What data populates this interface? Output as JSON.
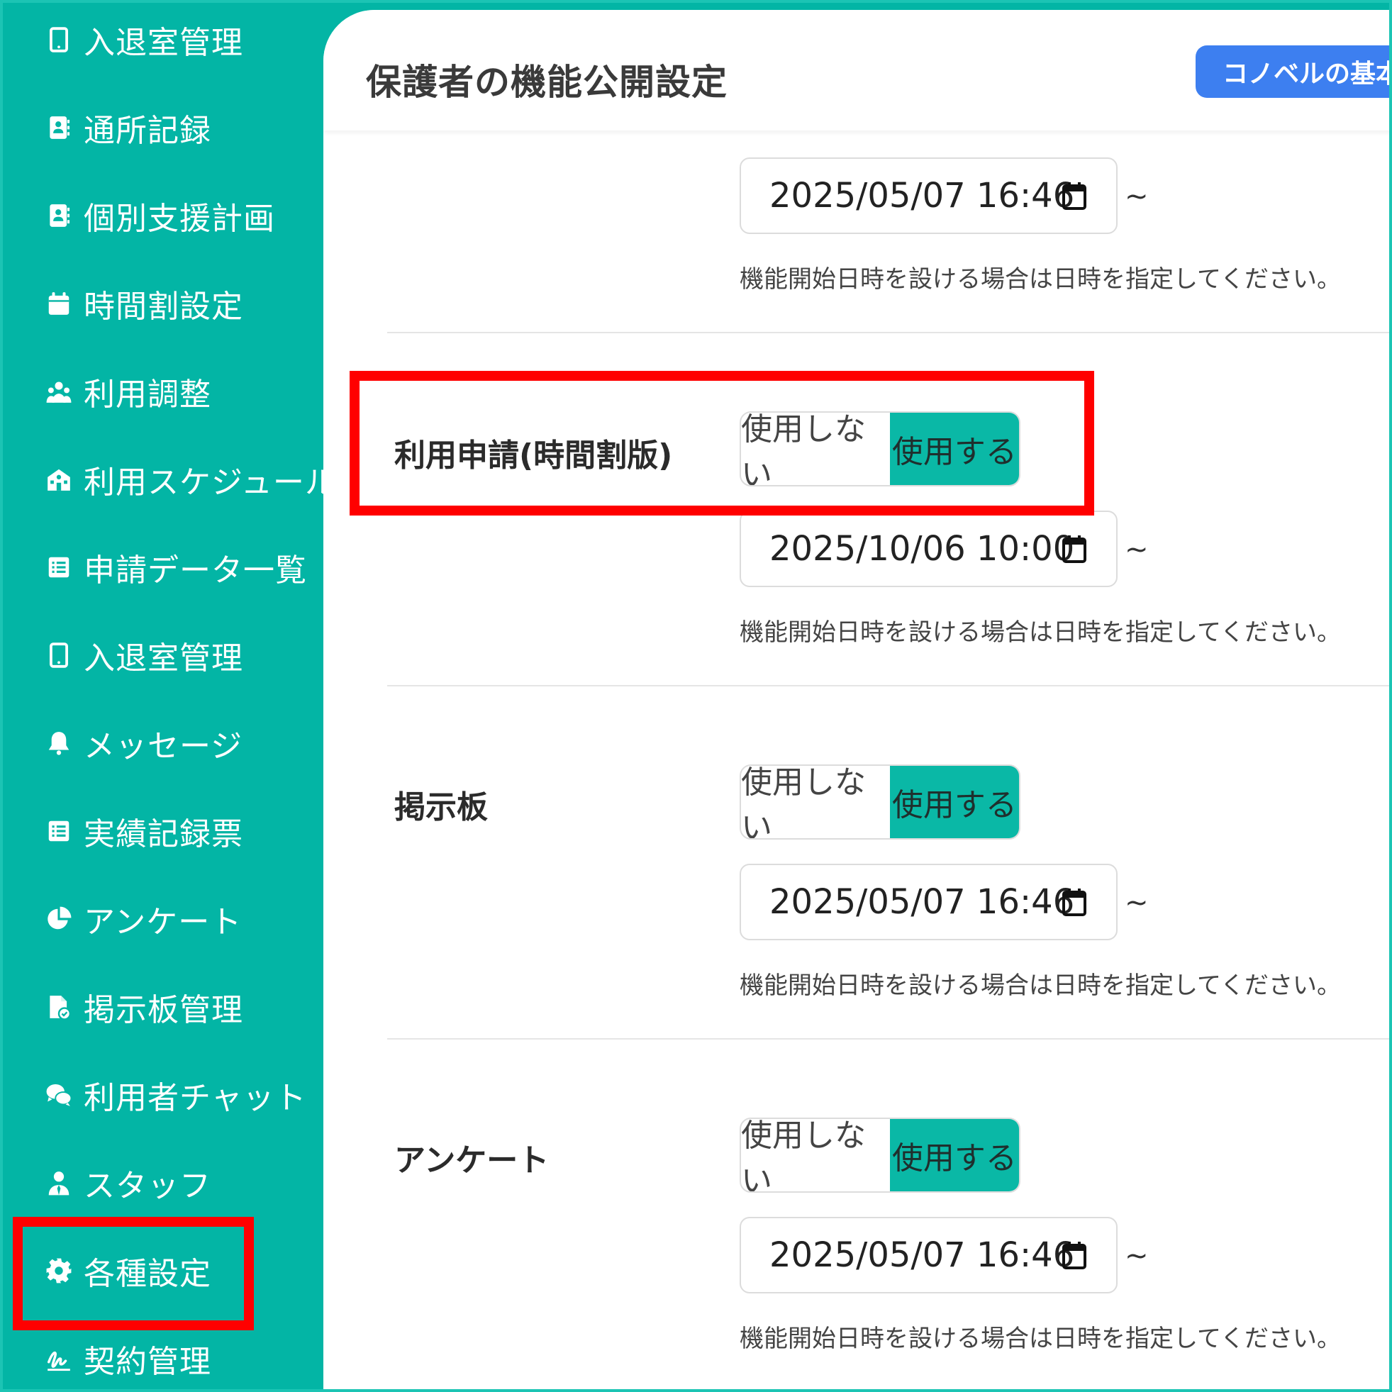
{
  "sidebar": {
    "items": [
      {
        "label": "入退室管理",
        "icon": "tablet-icon"
      },
      {
        "label": "通所記録",
        "icon": "contact-book-icon"
      },
      {
        "label": "個別支援計画",
        "icon": "contact-book-icon"
      },
      {
        "label": "時間割設定",
        "icon": "calendar-icon"
      },
      {
        "label": "利用調整",
        "icon": "people-group-icon"
      },
      {
        "label": "利用スケジュール",
        "icon": "school-building-icon"
      },
      {
        "label": "申請データ一覧",
        "icon": "list-icon"
      },
      {
        "label": "入退室管理",
        "icon": "tablet-icon"
      },
      {
        "label": "メッセージ",
        "icon": "bell-icon"
      },
      {
        "label": "実績記録票",
        "icon": "list-icon"
      },
      {
        "label": "アンケート",
        "icon": "pie-chart-icon"
      },
      {
        "label": "掲示板管理",
        "icon": "file-check-icon"
      },
      {
        "label": "利用者チャット",
        "icon": "chat-bubbles-icon"
      },
      {
        "label": "スタッフ",
        "icon": "staff-person-icon"
      },
      {
        "label": "各種設定",
        "icon": "gear-icon",
        "highlighted": true
      },
      {
        "label": "契約管理",
        "icon": "signature-icon"
      }
    ]
  },
  "header": {
    "title": "保護者の機能公開設定",
    "guide_button": "コノベルの基本的な"
  },
  "settings": {
    "top": {
      "date": "2025/05/07 16:46",
      "tilde": "~",
      "help": "機能開始日時を設ける場合は日時を指定してください。"
    },
    "rows": [
      {
        "label": "利用申請(時間割版)",
        "off_label": "使用しない",
        "on_label": "使用する",
        "selected": "使用する",
        "date": "2025/10/06 10:00",
        "tilde": "~",
        "help": "機能開始日時を設ける場合は日時を指定してください。",
        "highlighted": true
      },
      {
        "label": "掲示板",
        "off_label": "使用しない",
        "on_label": "使用する",
        "selected": "使用する",
        "date": "2025/05/07 16:46",
        "tilde": "~",
        "help": "機能開始日時を設ける場合は日時を指定してください。"
      },
      {
        "label": "アンケート",
        "off_label": "使用しない",
        "on_label": "使用する",
        "selected": "使用する",
        "date": "2025/05/07 16:46",
        "tilde": "~",
        "help": "機能開始日時を設ける場合は日時を指定してください。"
      }
    ]
  },
  "colors": {
    "sidebar_bg": "#03b5a5",
    "toggle_on": "#0ab8a6",
    "guide_button": "#3d7ff0",
    "annotation_red": "#ff0000"
  }
}
